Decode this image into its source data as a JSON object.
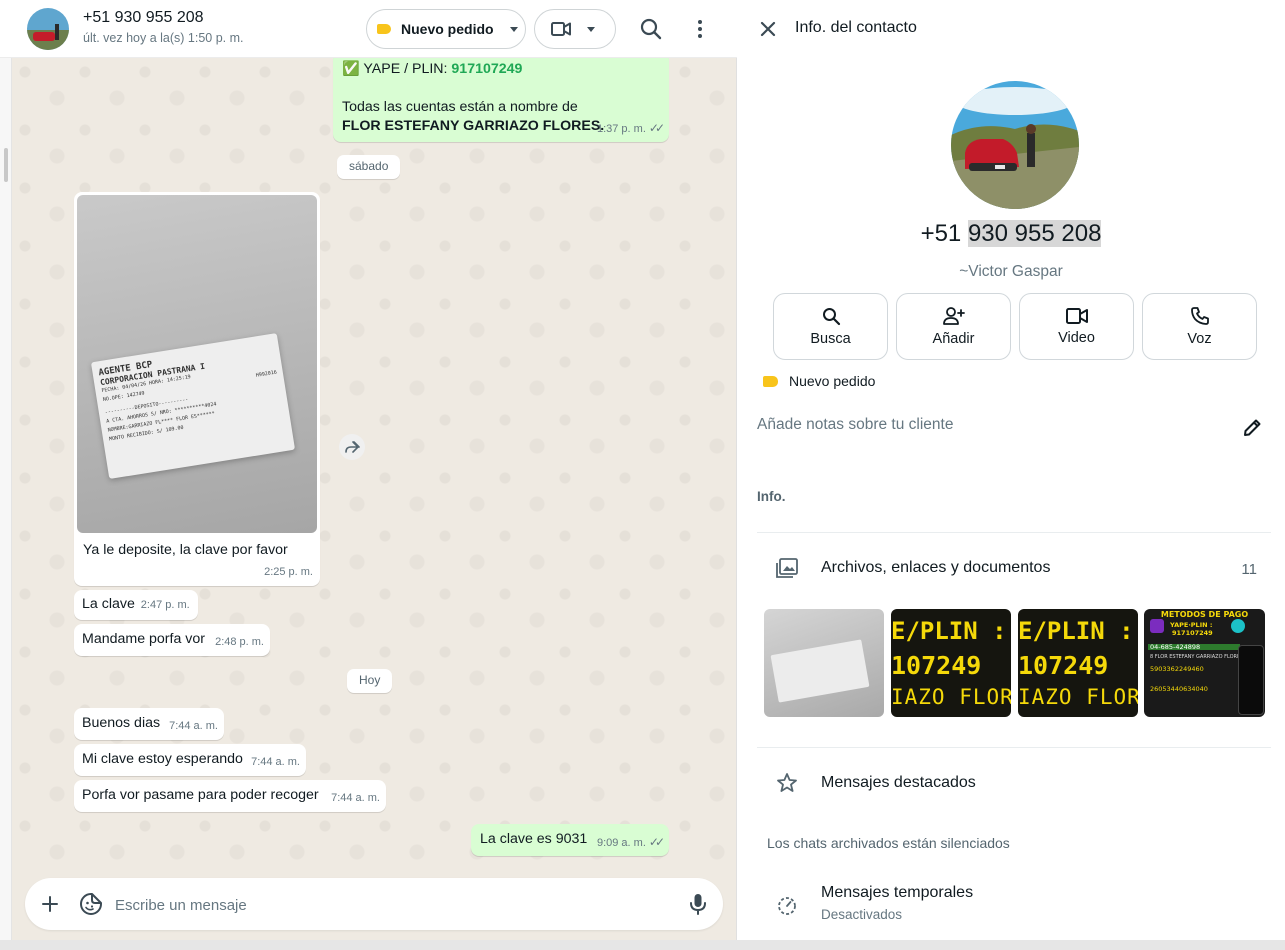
{
  "chat": {
    "contact_name": "+51 930 955 208",
    "last_seen": "últ. vez hoy a la(s) 1:50 p. m.",
    "label_button": "Nuevo pedido",
    "composer_placeholder": "Escribe un mensaje",
    "messages": [
      {
        "icon": "✅",
        "prefix": "YAPE / PLIN: ",
        "number": "917107249",
        "line2": "Todas las cuentas están a nombre de",
        "bold": "FLOR ESTEFANY GARRIAZO FLORES.",
        "time": "1:37 p. m."
      },
      {
        "day": "sábado"
      },
      {
        "caption": "Ya le deposite, la clave por favor",
        "time": "2:25 p. m."
      },
      {
        "text": "La clave",
        "time": "2:47 p. m."
      },
      {
        "text": "Mandame porfa vor",
        "time": "2:48 p. m."
      },
      {
        "day": "Hoy"
      },
      {
        "text": "Buenos dias",
        "time": "7:44 a. m."
      },
      {
        "text": "Mi clave estoy esperando",
        "time": "7:44 a. m."
      },
      {
        "text": "Porfa vor pasame para  poder recoger",
        "time": "7:44 a. m."
      },
      {
        "text": "La clave es 9031",
        "time": "9:09 a. m."
      }
    ],
    "receipt": {
      "l1": "AGENTE BCP",
      "l2": "CORPORACION PASTRANA I",
      "l3": "FECHA: 04/04/26  HORA: 14:25:19",
      "l4": "NO.OPE: 142749",
      "l5": "H992016",
      "l6": "----------DEPOSITO----------",
      "l7": "A CTA. AHORROS S/   NRO: **********4024",
      "l8": "NOMBRE:GARRIAZO FL**** FLOR ES******",
      "l9": "MONTO RECIBIDO:                S/    109.00"
    }
  },
  "info": {
    "title": "Info. del contacto",
    "phone_prefix": "+51 ",
    "phone_main": "930 955 208",
    "push_name": "~Victor Gaspar",
    "actions": [
      "Busca",
      "Añadir",
      "Video",
      "Voz"
    ],
    "label": "Nuevo pedido",
    "notes_placeholder": "Añade notas sobre tu cliente",
    "section_info": "Info.",
    "files_label": "Archivos, enlaces y documentos",
    "files_count": "11",
    "starred": "Mensajes destacados",
    "archived_note": "Los chats archivados están silenciados",
    "temp_title": "Mensajes temporales",
    "temp_sub": "Desactivados",
    "media_text": {
      "line1": "E/PLIN :",
      "line2": "107249",
      "line3": "IAZO FLOR",
      "methods_title": "METODOS DE PAGO",
      "methods_yape": "YAPE·PLIN :",
      "methods_num": "917107249",
      "methods_acc1": "04-685-424898",
      "methods_acc2": "8 FLOR ESTEFANY GARRIAZO FLORES",
      "methods_acc3": "5903362249460",
      "methods_acc4": "26053440634040"
    }
  },
  "colors": {
    "accent_green": "#1fa855",
    "bubble_out": "#d9fdd3",
    "label_yellow": "#f8c41b"
  }
}
